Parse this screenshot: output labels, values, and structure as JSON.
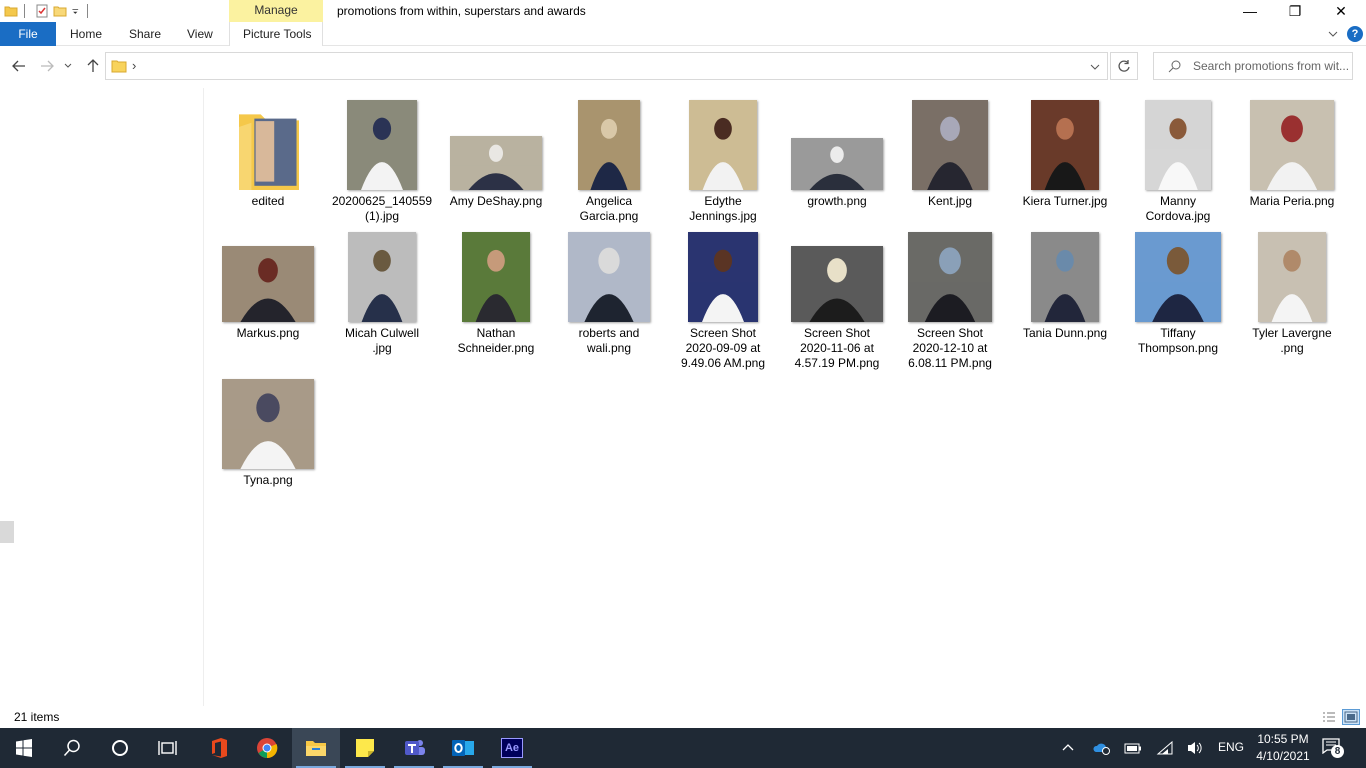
{
  "window": {
    "title": "promotions from within, superstars and awards",
    "manage_label": "Manage",
    "picture_tools_label": "Picture Tools",
    "minimize": "—",
    "maximize": "❐",
    "close": "✕"
  },
  "ribbon": {
    "file": "File",
    "home": "Home",
    "share": "Share",
    "view": "View",
    "help": "?"
  },
  "address": {
    "chevron": "›"
  },
  "search": {
    "placeholder": "Search promotions from wit..."
  },
  "status": {
    "count": "21 items"
  },
  "items": [
    {
      "label": "edited",
      "type": "folder"
    },
    {
      "label": "20200625_140559\n(1).jpg",
      "type": "image",
      "colors": [
        "#8a8a7a",
        "#f3f3f3",
        "#2a3355"
      ]
    },
    {
      "label": "Amy DeShay.png",
      "type": "image",
      "colors": [
        "#b9b2a0",
        "#2c3146",
        "#e9e7e3"
      ]
    },
    {
      "label": "Angelica\nGarcia.png",
      "type": "image",
      "colors": [
        "#a9946e",
        "#1e2846",
        "#d9c8a8"
      ]
    },
    {
      "label": "Edythe\nJennings.jpg",
      "type": "image",
      "colors": [
        "#cdbc94",
        "#f2f2f2",
        "#4a2c22"
      ]
    },
    {
      "label": "growth.png",
      "type": "image",
      "colors": [
        "#9a9a9a",
        "#2a2f3c",
        "#ececec"
      ]
    },
    {
      "label": "Kent.jpg",
      "type": "image",
      "colors": [
        "#7a6f66",
        "#262630",
        "#a8a8b8"
      ]
    },
    {
      "label": "Kiera Turner.jpg",
      "type": "image",
      "colors": [
        "#6a3a2a",
        "#181818",
        "#b57050"
      ]
    },
    {
      "label": "Manny\nCordova.jpg",
      "type": "image",
      "colors": [
        "#d5d5d5",
        "#f8f8f8",
        "#8a5a3a"
      ]
    },
    {
      "label": "Maria Peria.png",
      "type": "image",
      "colors": [
        "#c8c0b0",
        "#f2f2f2",
        "#9a3030"
      ]
    },
    {
      "label": "Markus.png",
      "type": "image",
      "colors": [
        "#9a8a76",
        "#24242c",
        "#6a2c24"
      ]
    },
    {
      "label": "Micah Culwell\n.jpg",
      "type": "image",
      "colors": [
        "#bcbcbc",
        "#26304a",
        "#6a5a40"
      ]
    },
    {
      "label": "Nathan\nSchneider.png",
      "type": "image",
      "colors": [
        "#5a7a3a",
        "#2a2a30",
        "#c69a7a"
      ]
    },
    {
      "label": "roberts and\nwali.png",
      "type": "image",
      "colors": [
        "#b0b8c8",
        "#1e2430",
        "#dadada"
      ]
    },
    {
      "label": "Screen Shot\n2020-09-09 at\n9.49.06 AM.png",
      "type": "image",
      "colors": [
        "#2a3470",
        "#f4f4f4",
        "#5a3424"
      ]
    },
    {
      "label": "Screen Shot\n2020-11-06 at\n4.57.19 PM.png",
      "type": "image",
      "colors": [
        "#5a5a5a",
        "#1c1c1c",
        "#e8e0c8"
      ]
    },
    {
      "label": "Screen Shot\n2020-12-10 at\n6.08.11 PM.png",
      "type": "image",
      "colors": [
        "#6a6a66",
        "#1c1c22",
        "#8aa0b8"
      ]
    },
    {
      "label": "Tania Dunn.png",
      "type": "image",
      "colors": [
        "#8a8a8a",
        "#22263a",
        "#6a8aaa"
      ]
    },
    {
      "label": "Tiffany\nThompson.png",
      "type": "image",
      "colors": [
        "#6a9ad0",
        "#1e2642",
        "#7a5a3a"
      ]
    },
    {
      "label": "Tyler Lavergne\n.png",
      "type": "image",
      "colors": [
        "#c8c0b2",
        "#f4f4f4",
        "#b08a6a"
      ]
    },
    {
      "label": "Tyna.png",
      "type": "image",
      "colors": [
        "#a89a88",
        "#f4f4f4",
        "#4a4a60"
      ]
    }
  ],
  "taskbar": {
    "time": "10:55 PM",
    "date": "4/10/2021",
    "lang": "ENG",
    "notifications": "8",
    "apps": [
      "windows-start",
      "search",
      "cortana",
      "task-view",
      "office",
      "chrome",
      "file-explorer",
      "sticky-notes",
      "teams",
      "outlook",
      "after-effects"
    ]
  }
}
